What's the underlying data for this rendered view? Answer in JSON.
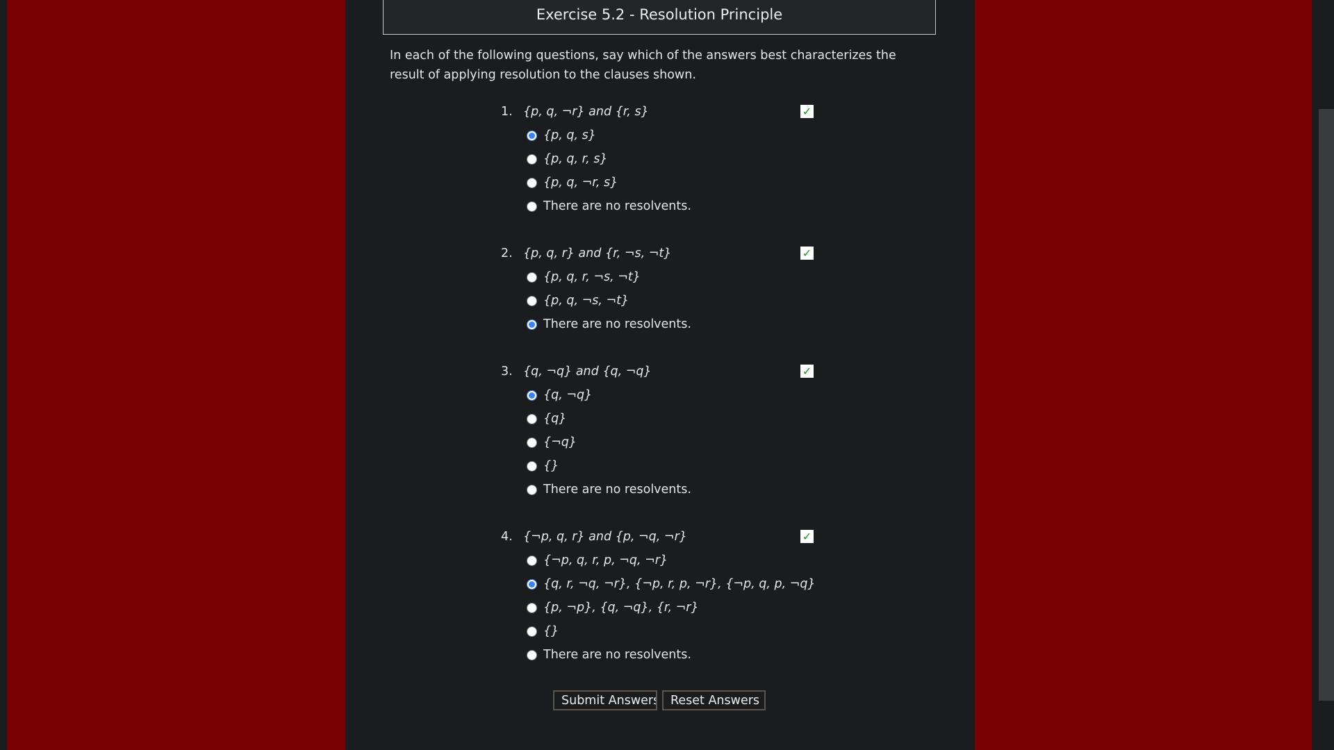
{
  "title": "Exercise 5.2 - Resolution Principle",
  "description": "In each of the following questions, say which of the answers best characterizes the result of applying resolution to the clauses shown.",
  "accent_color": "#3b82f6",
  "questions": [
    {
      "number": "1.",
      "clauses": "{p, q, ¬r} and {r, s}",
      "correct": true,
      "options": [
        "{p, q, s}",
        "{p, q, r, s}",
        "{p, q, ¬r, s}",
        "There are no resolvents."
      ],
      "selected": 0
    },
    {
      "number": "2.",
      "clauses": "{p, q, r} and {r, ¬s, ¬t}",
      "correct": true,
      "options": [
        "{p, q, r, ¬s, ¬t}",
        "{p, q, ¬s, ¬t}",
        "There are no resolvents."
      ],
      "selected": 2
    },
    {
      "number": "3.",
      "clauses": "{q, ¬q} and {q, ¬q}",
      "correct": true,
      "options": [
        "{q, ¬q}",
        "{q}",
        "{¬q}",
        "{}",
        "There are no resolvents."
      ],
      "selected": 0
    },
    {
      "number": "4.",
      "clauses": "{¬p, q, r} and {p, ¬q, ¬r}",
      "correct": true,
      "options": [
        "{¬p, q, r, p, ¬q, ¬r}",
        "{q, r, ¬q, ¬r}, {¬p, r, p, ¬r}, {¬p, q, p, ¬q}",
        "{p, ¬p}, {q, ¬q}, {r, ¬r}",
        "{}",
        "There are no resolvents."
      ],
      "selected": 1
    }
  ],
  "check_icon": "✓",
  "buttons": {
    "submit": "Submit Answers",
    "reset": "Reset Answers"
  }
}
